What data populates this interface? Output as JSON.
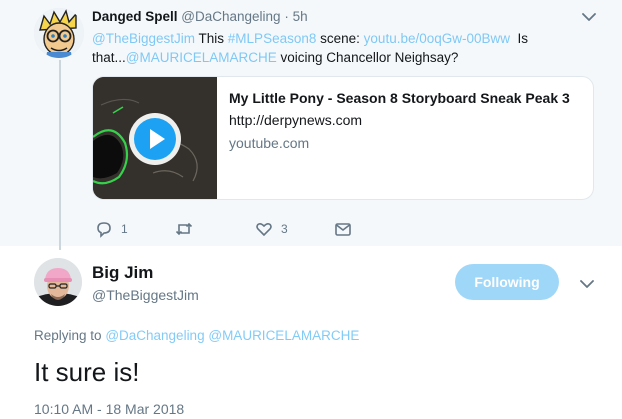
{
  "reply_tweet": {
    "author_name": "Danged Spell",
    "author_handle": "@DaChangeling",
    "separator": "·",
    "time": "5h",
    "text_mention": "@TheBiggestJim",
    "text_part1": "This",
    "text_hashtag": "#MLPSeason8",
    "text_part2": "scene:",
    "text_link": "youtu.be/0oqGw-00Bww",
    "text_part3": "Is that...",
    "text_mention2": "@MAURICELAMARCHE",
    "text_part4": "voicing Chancellor Neighsay?",
    "card": {
      "title": "My Little Pony - Season 8 Storyboard Sneak Peak 3",
      "url": "http://derpynews.com",
      "domain": "youtube.com",
      "play_icon": "play-icon"
    },
    "actions": {
      "reply_icon": "reply-icon",
      "reply_count": "1",
      "retweet_icon": "retweet-icon",
      "like_icon": "heart-icon",
      "like_count": "3",
      "dm_icon": "envelope-icon"
    }
  },
  "main_tweet": {
    "author_name": "Big Jim",
    "author_handle": "@TheBiggestJim",
    "follow_label": "Following",
    "replying_to_label": "Replying to",
    "replying_to_1": "@DaChangeling",
    "replying_to_2": "@MAURICELAMARCHE",
    "text": "It sure is!",
    "timestamp": "10:10 AM - 18 Mar 2018"
  },
  "colors": {
    "accent": "#1da1f2",
    "muted": "#657786",
    "reply_background": "#f5f8fa"
  }
}
